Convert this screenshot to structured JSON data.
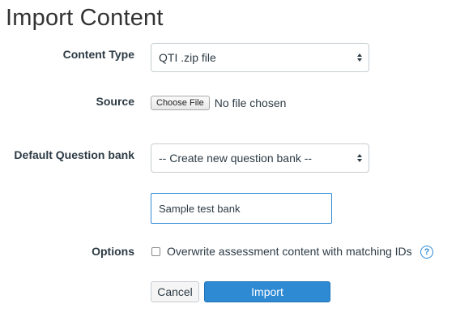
{
  "page": {
    "title": "Import Content"
  },
  "form": {
    "content_type": {
      "label": "Content Type",
      "value": "QTI .zip file"
    },
    "source": {
      "label": "Source",
      "button_label": "Choose File",
      "status": "No file chosen"
    },
    "question_bank": {
      "label": "Default Question bank",
      "value": "-- Create new question bank --",
      "new_bank_name": "Sample test bank"
    },
    "options": {
      "label": "Options",
      "overwrite_label": "Overwrite assessment content with matching IDs",
      "overwrite_checked": false,
      "help_glyph": "?"
    },
    "actions": {
      "cancel_label": "Cancel",
      "import_label": "Import"
    }
  },
  "colors": {
    "accent": "#2f8ad4",
    "text": "#2d3b45"
  },
  "icons": {
    "select_caret": "up-down-caret-icon",
    "help": "question-circle-icon"
  }
}
